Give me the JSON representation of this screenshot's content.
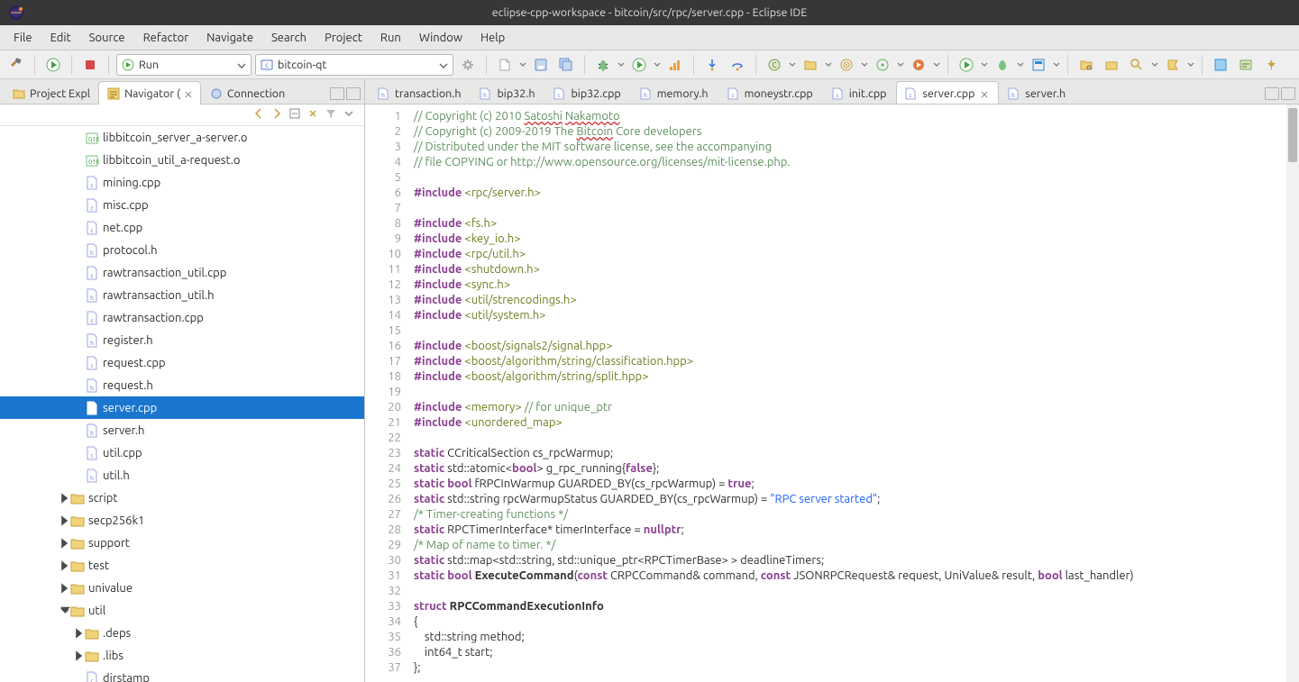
{
  "window": {
    "title": "eclipse-cpp-workspace - bitcoin/src/rpc/server.cpp - Eclipse IDE"
  },
  "menubar": [
    "File",
    "Edit",
    "Source",
    "Refactor",
    "Navigate",
    "Search",
    "Project",
    "Run",
    "Window",
    "Help"
  ],
  "toolbar": {
    "run_mode_label": "Run",
    "launch_target_label": "bitcoin-qt"
  },
  "left_view": {
    "tabs": [
      {
        "label": "Project Expl",
        "icon": "project-explorer-icon",
        "active": false
      },
      {
        "label": "Navigator (",
        "icon": "navigator-icon",
        "active": true
      },
      {
        "label": "Connection",
        "icon": "connections-icon",
        "active": false
      }
    ]
  },
  "tree": [
    {
      "depth": 4,
      "kind": "obj",
      "label": "libbitcoin_server_a-server.o"
    },
    {
      "depth": 4,
      "kind": "obj",
      "label": "libbitcoin_util_a-request.o"
    },
    {
      "depth": 4,
      "kind": "cpp",
      "label": "mining.cpp"
    },
    {
      "depth": 4,
      "kind": "cpp",
      "label": "misc.cpp"
    },
    {
      "depth": 4,
      "kind": "cpp",
      "label": "net.cpp"
    },
    {
      "depth": 4,
      "kind": "h",
      "label": "protocol.h"
    },
    {
      "depth": 4,
      "kind": "cpp",
      "label": "rawtransaction_util.cpp"
    },
    {
      "depth": 4,
      "kind": "h",
      "label": "rawtransaction_util.h"
    },
    {
      "depth": 4,
      "kind": "cpp",
      "label": "rawtransaction.cpp"
    },
    {
      "depth": 4,
      "kind": "h",
      "label": "register.h"
    },
    {
      "depth": 4,
      "kind": "cpp",
      "label": "request.cpp"
    },
    {
      "depth": 4,
      "kind": "h",
      "label": "request.h"
    },
    {
      "depth": 4,
      "kind": "cpp",
      "label": "server.cpp",
      "selected": true
    },
    {
      "depth": 4,
      "kind": "h",
      "label": "server.h"
    },
    {
      "depth": 4,
      "kind": "cpp",
      "label": "util.cpp"
    },
    {
      "depth": 4,
      "kind": "h",
      "label": "util.h"
    },
    {
      "depth": 3,
      "kind": "folder",
      "label": "script",
      "twist": "closed"
    },
    {
      "depth": 3,
      "kind": "folder",
      "label": "secp256k1",
      "twist": "closed"
    },
    {
      "depth": 3,
      "kind": "folder",
      "label": "support",
      "twist": "closed"
    },
    {
      "depth": 3,
      "kind": "folder",
      "label": "test",
      "twist": "closed"
    },
    {
      "depth": 3,
      "kind": "folder",
      "label": "univalue",
      "twist": "closed"
    },
    {
      "depth": 3,
      "kind": "folder",
      "label": "util",
      "twist": "open"
    },
    {
      "depth": 4,
      "kind": "folder",
      "label": ".deps",
      "twist": "closed"
    },
    {
      "depth": 4,
      "kind": "folder",
      "label": ".libs",
      "twist": "closed"
    },
    {
      "depth": 4,
      "kind": "file",
      "label": "dirstamp"
    }
  ],
  "editor_tabs": [
    {
      "label": "transaction.h",
      "icon": "h"
    },
    {
      "label": "bip32.h",
      "icon": "h"
    },
    {
      "label": "bip32.cpp",
      "icon": "cpp"
    },
    {
      "label": "memory.h",
      "icon": "h"
    },
    {
      "label": "moneystr.cpp",
      "icon": "cpp"
    },
    {
      "label": "init.cpp",
      "icon": "cpp"
    },
    {
      "label": "server.cpp",
      "icon": "cpp",
      "active": true
    },
    {
      "label": "server.h",
      "icon": "h"
    }
  ],
  "editor": {
    "first_line": 1,
    "lines": [
      {
        "t": "cm",
        "s": "// Copyright (c) 2010 Satoshi Nakamoto",
        "wavy": [
          "Satoshi",
          "Nakamoto"
        ]
      },
      {
        "t": "cm",
        "s": "// Copyright (c) 2009-2019 The Bitcoin Core developers",
        "wavy": [
          "Bitcoin"
        ]
      },
      {
        "t": "cm",
        "s": "// Distributed under the MIT software license, see the accompanying"
      },
      {
        "t": "cm",
        "s": "// file COPYING or http://www.opensource.org/licenses/mit-license.php."
      },
      {
        "t": "",
        "s": ""
      },
      {
        "t": "inc",
        "kw": "#include",
        "path": "<rpc/server.h>"
      },
      {
        "t": "",
        "s": ""
      },
      {
        "t": "inc",
        "kw": "#include",
        "path": "<fs.h>"
      },
      {
        "t": "inc",
        "kw": "#include",
        "path": "<key_io.h>"
      },
      {
        "t": "inc",
        "kw": "#include",
        "path": "<rpc/util.h>"
      },
      {
        "t": "inc",
        "kw": "#include",
        "path": "<shutdown.h>"
      },
      {
        "t": "inc",
        "kw": "#include",
        "path": "<sync.h>"
      },
      {
        "t": "inc",
        "kw": "#include",
        "path": "<util/strencodings.h>"
      },
      {
        "t": "inc",
        "kw": "#include",
        "path": "<util/system.h>"
      },
      {
        "t": "",
        "s": ""
      },
      {
        "t": "inc",
        "kw": "#include",
        "path": "<boost/signals2/signal.hpp>"
      },
      {
        "t": "inc",
        "kw": "#include",
        "path": "<boost/algorithm/string/classification.hpp>"
      },
      {
        "t": "inc",
        "kw": "#include",
        "path": "<boost/algorithm/string/split.hpp>"
      },
      {
        "t": "",
        "s": ""
      },
      {
        "t": "inc2",
        "kw": "#include",
        "path": "<memory>",
        "tail": " // for unique_ptr"
      },
      {
        "t": "inc",
        "kw": "#include",
        "path": "<unordered_map>"
      },
      {
        "t": "",
        "s": ""
      },
      {
        "t": "code",
        "html": "<span class='kw2'>static</span> CCriticalSection cs_rpcWarmup;"
      },
      {
        "t": "code",
        "html": "<span class='kw2'>static</span> std::atomic&lt;<span class='kw2'>bool</span>&gt; g_rpc_running{<span class='kw2'>false</span>};"
      },
      {
        "t": "code",
        "html": "<span class='kw2'>static</span> <span class='kw2'>bool</span> fRPCInWarmup GUARDED_BY(cs_rpcWarmup) = <span class='kw2'>true</span>;"
      },
      {
        "t": "code",
        "html": "<span class='kw2'>static</span> std::string rpcWarmupStatus GUARDED_BY(cs_rpcWarmup) = <span class='str'>&quot;RPC server started&quot;</span>;"
      },
      {
        "t": "cm",
        "s": "/* Timer-creating functions */"
      },
      {
        "t": "code",
        "html": "<span class='kw2'>static</span> RPCTimerInterface* timerInterface = <span class='kw2'>nullptr</span>;"
      },
      {
        "t": "cm",
        "s": "/* Map of name to timer. */"
      },
      {
        "t": "code",
        "html": "<span class='kw2'>static</span> std::map&lt;std::string, std::unique_ptr&lt;RPCTimerBase&gt; &gt; deadlineTimers;"
      },
      {
        "t": "code",
        "html": "<span class='kw2'>static</span> <span class='kw2'>bool</span> <span class='bold'>ExecuteCommand</span>(<span class='kw2'>const</span> CRPCCommand&amp; command, <span class='kw2'>const</span> JSONRPCRequest&amp; request, UniValue&amp; result, <span class='kw2'>bool</span> last_handler)"
      },
      {
        "t": "",
        "s": ""
      },
      {
        "t": "code",
        "html": "<span class='kw2'>struct</span> <span class='bold'>RPCCommandExecutionInfo</span>"
      },
      {
        "t": "code",
        "html": "{"
      },
      {
        "t": "code",
        "html": "    std::string method;"
      },
      {
        "t": "code",
        "html": "    int64_t start;"
      },
      {
        "t": "code",
        "html": "};"
      }
    ]
  }
}
